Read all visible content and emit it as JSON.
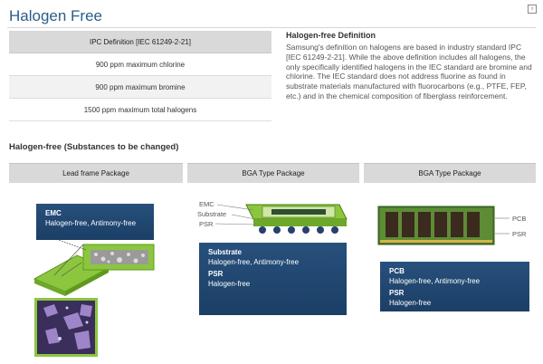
{
  "header": {
    "title": "Halogen Free",
    "corner_icon": "square-icon"
  },
  "definition_table": {
    "header": "IPC Definition [IEC 61249-2-21]",
    "rows": [
      "900 ppm maximum chlorine",
      "900 ppm maximum bromine",
      "1500 ppm maximum total halogens"
    ]
  },
  "definition": {
    "title": "Halogen-free Definition",
    "text": "Samsung's definition on halogens are based in industry standard IPC [IEC 61249-2-21]. While the above definition includes all halogens, the only specifically identified halogens in the IEC standard are bromine and chlorine. The IEC standard does not address fluorine as found in substrate materials manufactured with fluorocarbons (e.g., PTFE, FEP, etc.) and in the chemical composition of fiberglass reinforcement."
  },
  "section": {
    "title": "Halogen-free (Substances to be changed)"
  },
  "packages": [
    {
      "header": "Lead frame Package",
      "box_lines": [
        {
          "title": "EMC",
          "desc": "Halogen-free, Antimony-free"
        }
      ]
    },
    {
      "header": "BGA Type Package",
      "labels": [
        "EMC",
        "Substrate",
        "PSR"
      ],
      "box_lines": [
        {
          "title": "Substrate",
          "desc": "Halogen-free, Antimony-free"
        },
        {
          "title": "PSR",
          "desc": "Halogen-free"
        }
      ]
    },
    {
      "header": "BGA Type Package",
      "labels": [
        "PCB",
        "PSR"
      ],
      "box_lines": [
        {
          "title": "PCB",
          "desc": "Halogen-free, Antimony-free"
        },
        {
          "title": "PSR",
          "desc": "Halogen-free"
        }
      ]
    }
  ],
  "colors": {
    "title_blue": "#2a5d8a",
    "navy": "#1f4670",
    "green": "#8cc63f",
    "gray_header": "#d9d9d9"
  }
}
